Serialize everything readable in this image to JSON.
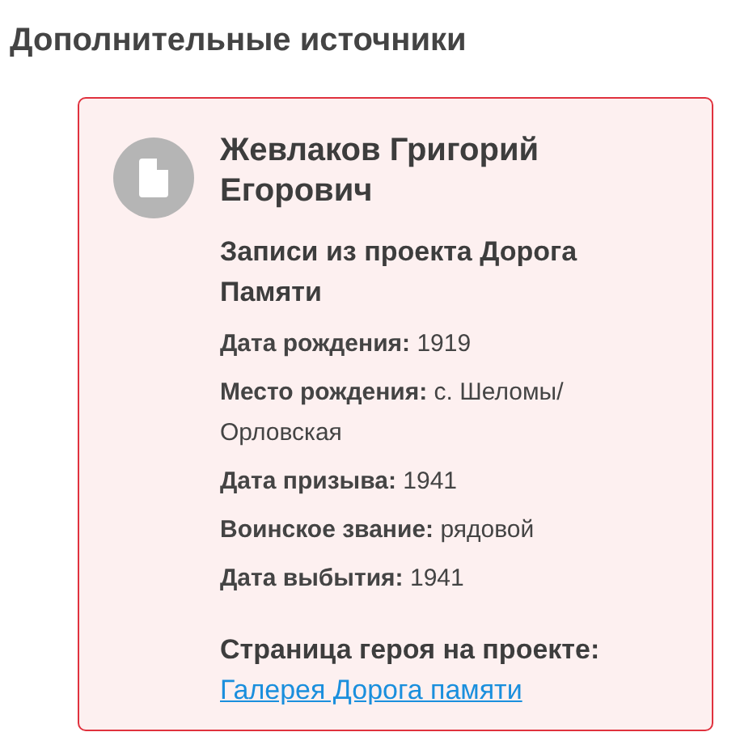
{
  "heading": "Дополнительные источники",
  "card": {
    "name": "Жевлаков Григорий Егорович",
    "subtitle": "Записи из проекта Дорога Памяти",
    "fields": [
      {
        "label": "Дата рождения:",
        "value": "1919"
      },
      {
        "label": "Место рождения:",
        "value": "с. Шеломы/ Орловская"
      },
      {
        "label": "Дата призыва:",
        "value": "1941"
      },
      {
        "label": "Воинское звание:",
        "value": "рядовой"
      },
      {
        "label": "Дата выбытия:",
        "value": "1941"
      }
    ],
    "hero_label": "Страница героя на проекте:",
    "link": "Галерея Дорога памяти"
  }
}
